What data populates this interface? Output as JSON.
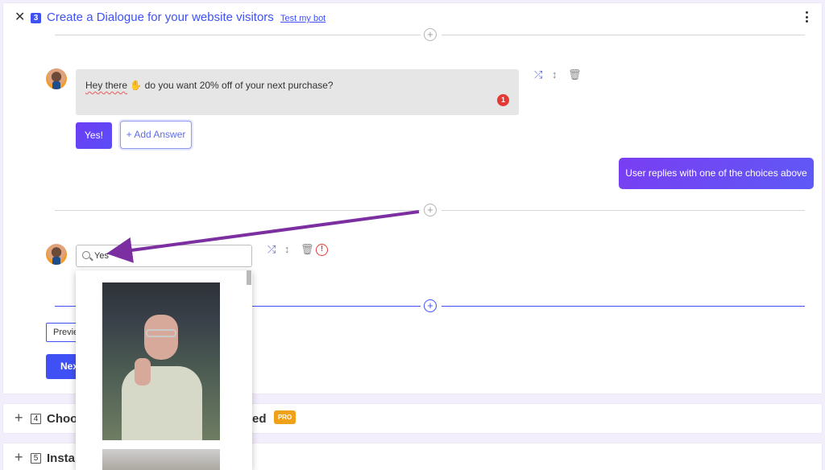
{
  "panel": {
    "step_number": "3",
    "title": "Create a Dialogue for your website visitors",
    "test_link": "Test my bot"
  },
  "bot_message": {
    "text_hey": "Hey there",
    "text_rest": " do you want 20% off of your next purchase?",
    "error_count": "1"
  },
  "answers": {
    "yes_label": "Yes!",
    "add_answer_label": "+ Add Answer"
  },
  "user_reply": {
    "label": "User replies with one of the choices above"
  },
  "gif_search": {
    "value": "Yes"
  },
  "footer": {
    "preview_label": "Previe",
    "next_label": "Nex"
  },
  "steps": [
    {
      "number": "4",
      "title": "Choos",
      "tail": "ed",
      "badge": "PRO"
    },
    {
      "number": "5",
      "title": "Instal"
    }
  ],
  "colors": {
    "accent": "#3f51f5",
    "bubble_bg": "#e6e6e6",
    "user_reply_gradient": [
      "#7a3df2",
      "#5e5af6"
    ],
    "pro_badge": "#f0a11a",
    "error": "#e53935",
    "arrow": "#7b2fa0"
  },
  "icons": {
    "shuffle": "shuffle-icon",
    "move": "move-vertical-icon",
    "delete": "trash-icon",
    "warning": "error-circle-icon"
  }
}
